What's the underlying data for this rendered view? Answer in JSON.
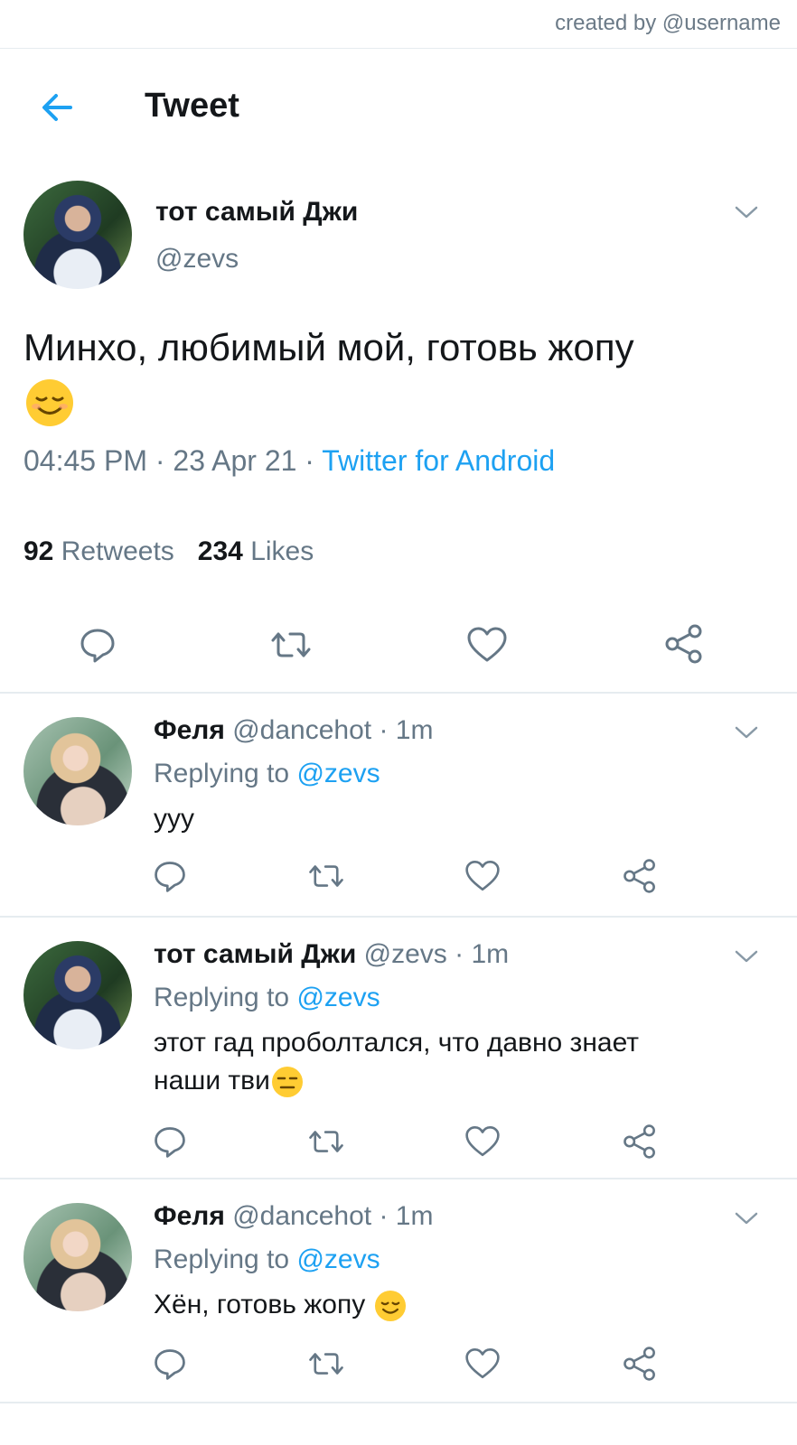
{
  "credit": "created by @username",
  "header": {
    "title": "Tweet"
  },
  "main_tweet": {
    "name": "тот самый Джи",
    "handle": "@zevs",
    "text": "Минхо, любимый мой, готовь жопу",
    "time": "04:45 PM",
    "sep1": " · ",
    "date": "23 Apr 21",
    "sep2": " · ",
    "source": "Twitter for Android",
    "retweets_count": "92",
    "retweets_label": "Retweets",
    "likes_count": "234",
    "likes_label": "Likes"
  },
  "replies": [
    {
      "name": "Феля",
      "handle": "@dancehot",
      "time": "· 1m",
      "replying_prefix": "Replying to",
      "replying_to": "@zevs",
      "text": "ууу"
    },
    {
      "name": "тот самый Джи",
      "handle": "@zevs",
      "time": "· 1m",
      "replying_prefix": "Replying to",
      "replying_to": "@zevs",
      "text_line1": "этот гад проболтался, что давно знает",
      "text_line2": "наши тви"
    },
    {
      "name": "Феля",
      "handle": "@dancehot",
      "time": "· 1m",
      "replying_prefix": "Replying to",
      "replying_to": "@zevs",
      "text": "Хён, готовь жопу"
    }
  ],
  "colors": {
    "accent": "#1da1f2",
    "text": "#14171a",
    "muted": "#657786",
    "divider": "#e6ecf0"
  },
  "icons": [
    "back-arrow-icon",
    "chevron-down-icon",
    "reply-icon",
    "retweet-icon",
    "like-icon",
    "share-icon",
    "relieved-face-emoji",
    "expressionless-face-emoji"
  ]
}
